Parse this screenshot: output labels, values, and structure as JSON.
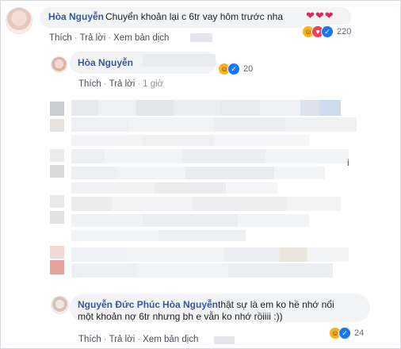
{
  "comments": [
    {
      "author": "Hòa Nguyễn",
      "text": "Chuyển khoản lại c 6tr vay hôm trước nha",
      "emoji": "❤❤❤",
      "actions": [
        "Thích",
        "Trả lời",
        "Xem bản dịch"
      ],
      "reaction_count": "220",
      "reactions": [
        "haha-icon",
        "love-icon",
        "like-icon"
      ]
    }
  ],
  "replies": [
    {
      "author": "Hòa Nguyễn",
      "actions": [
        "Thích",
        "Trả lời"
      ],
      "time": "1 giờ",
      "reaction_count": "20",
      "reactions": [
        "haha-icon",
        "like-icon"
      ]
    },
    {
      "author": "Nguyễn Đức Phúc",
      "mention": "Hòa Nguyễn",
      "text_line1": "thật sự là em ko hề nhớ nổi",
      "text_line2": "một khoản nợ 6tr nhưng bh e vẫn ko nhớ rồiiii :))",
      "actions": [
        "Thích",
        "Trả lời",
        "Xem bản dịch"
      ],
      "reaction_count": "24",
      "reactions": [
        "haha-icon",
        "like-icon"
      ]
    }
  ],
  "censored_fragment": "i",
  "colors": {
    "name_link": "#385898",
    "bubble_bg": "#f2f3f5",
    "action_text": "#4b4f56",
    "haha": "#f7b125",
    "love": "#f33e58",
    "like": "#1877f2"
  }
}
